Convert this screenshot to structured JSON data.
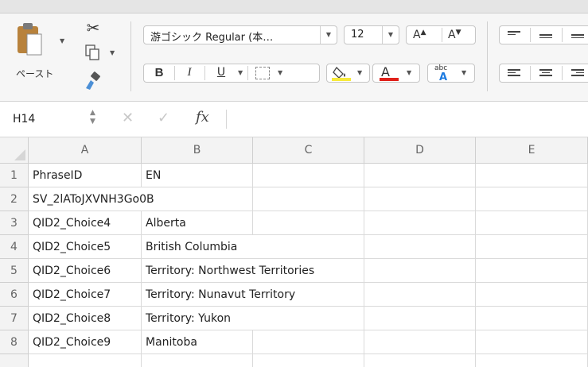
{
  "ribbon": {
    "paste_label": "ペースト",
    "font_name": "游ゴシック Regular (本…",
    "font_size": "12",
    "increase_font": "A",
    "decrease_font": "A",
    "bold": "B",
    "italic": "I",
    "underline": "U",
    "font_color_glyph": "A",
    "abc_label": "abc",
    "abc_a": "A",
    "fill_color": "#f7ea3b",
    "font_color": "#e0211a",
    "icons": [
      "paste-icon",
      "cut-icon",
      "copy-icon",
      "format-painter-icon",
      "borders-icon",
      "fill-color-icon",
      "font-color-icon",
      "text-direction-icon",
      "align-icon"
    ]
  },
  "formula_bar": {
    "name_box": "H14",
    "fx": "fx",
    "cancel_icon": "✕",
    "enter_icon": "✓"
  },
  "sheet": {
    "columns": [
      "A",
      "B",
      "C",
      "D",
      "E"
    ],
    "rows": [
      {
        "num": "1",
        "A": "PhraseID",
        "B": "EN"
      },
      {
        "num": "2",
        "A": "SV_2lAToJXVNH3Go0B",
        "B": ""
      },
      {
        "num": "3",
        "A": "QID2_Choice4",
        "B": "Alberta"
      },
      {
        "num": "4",
        "A": "QID2_Choice5",
        "B": "British Columbia"
      },
      {
        "num": "5",
        "A": "QID2_Choice6",
        "B": "Territory: Northwest Territories"
      },
      {
        "num": "6",
        "A": "QID2_Choice7",
        "B": "Territory: Nunavut Territory"
      },
      {
        "num": "7",
        "A": "QID2_Choice8",
        "B": "Territory: Yukon"
      },
      {
        "num": "8",
        "A": "QID2_Choice9",
        "B": "Manitoba"
      }
    ]
  }
}
